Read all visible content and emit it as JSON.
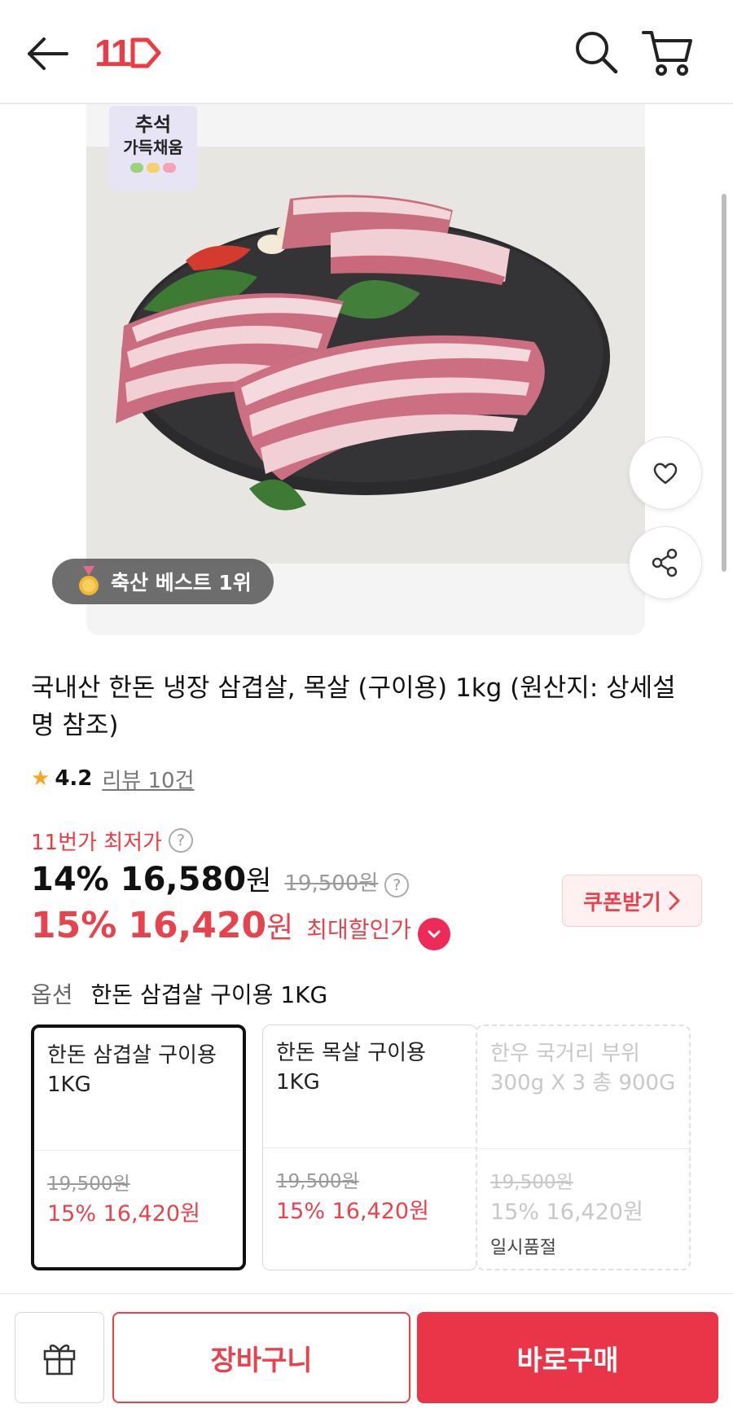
{
  "header": {
    "logo_text": "11",
    "icons": [
      "back-arrow-icon",
      "search-icon",
      "cart-icon"
    ]
  },
  "gallery": {
    "promo_badge_line1": "추석",
    "promo_badge_line2": "가득채움",
    "best_badge": "축산 베스트 1위",
    "icons": [
      "heart-icon",
      "share-icon",
      "medal-icon"
    ]
  },
  "product": {
    "title": "국내산 한돈 냉장 삼겹살, 목살 (구이용) 1kg (원산지: 상세설명 참조)",
    "rating": "4.2",
    "review_link": "리뷰 10건"
  },
  "price": {
    "lowest_label": "11번가 최저가",
    "help_mark": "?",
    "discount_pct": "14%",
    "sale_amount": "16,580",
    "won": "원",
    "original_price": "19,500원",
    "max_discount_pct": "15%",
    "max_sale_amount": "16,420",
    "max_label": "최대할인가",
    "coupon_button": "쿠폰받기"
  },
  "options": {
    "label": "옵션",
    "selected_value": "한돈 삼겹살 구이용 1KG",
    "cards": [
      {
        "name": "한돈 삼겹살 구이용 1KG",
        "orig": "19,500원",
        "sale": "15% 16,420원",
        "status": ""
      },
      {
        "name": "한돈 목살 구이용 1KG",
        "orig": "19,500원",
        "sale": "15% 16,420원",
        "status": ""
      },
      {
        "name": "한우 국거리 부위 300g X 3 총 900G",
        "orig": "19,500원",
        "sale": "15% 16,420원",
        "status": "일시품절"
      }
    ]
  },
  "bottom_bar": {
    "cart_button": "장바구니",
    "buy_button": "바로구매",
    "icons": [
      "gift-icon"
    ]
  },
  "colors": {
    "accent_red": "#e7434d",
    "buy_button": "#ea3447",
    "star": "#f5a623"
  }
}
